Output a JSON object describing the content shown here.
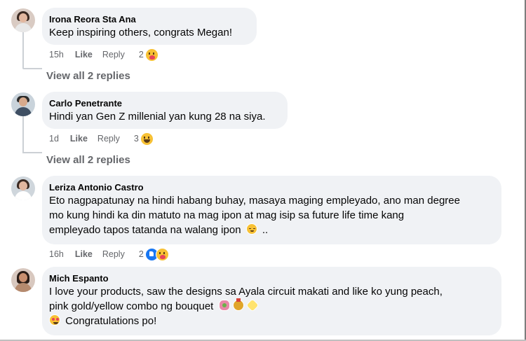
{
  "comments": [
    {
      "author": "Irona Reora Sta Ana",
      "lines": [
        "Keep inspiring others, congrats Megan!"
      ],
      "time": "15h",
      "like": "Like",
      "reply": "Reply",
      "reaction_count": "2",
      "reaction_icons": [
        "care-emoji"
      ],
      "view_replies": "View all 2 replies"
    },
    {
      "author": "Carlo Penetrante",
      "lines": [
        "Hindi yan Gen Z millenial yan kung 28 na siya."
      ],
      "time": "1d",
      "like": "Like",
      "reply": "Reply",
      "reaction_count": "3",
      "reaction_icons": [
        "laugh-emoji"
      ],
      "view_replies": "View all 2 replies"
    },
    {
      "author": "Leriza Antonio Castro",
      "lines": [
        "Eto nagpapatunay na hindi habang buhay, masaya maging empleyado, ano man degree",
        "mo kung hindi ka din matuto na mag ipon at mag isip sa future life time kang",
        "empleyado tapos tatanda na walang ipon",
        ".."
      ],
      "time": "16h",
      "like": "Like",
      "reply": "Reply",
      "reaction_count": "2",
      "reaction_icons": [
        "like-emoji",
        "care-emoji"
      ]
    },
    {
      "author": "Mich Espanto",
      "lines": [
        "I love your products, saw the designs sa Ayala circuit makati and like ko yung peach,",
        "pink gold/yellow combo ng bouquet",
        "Congratulations po!"
      ]
    }
  ],
  "colors": {
    "bubble": "#f0f2f5",
    "meta": "#65676b",
    "text": "#050505",
    "like_blue": "#1877f2"
  }
}
